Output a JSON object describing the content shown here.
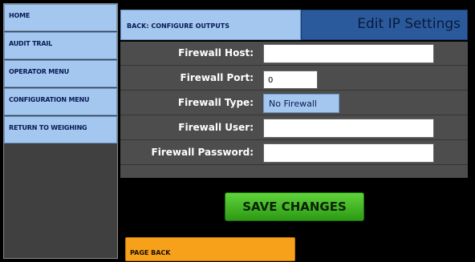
{
  "sidebar": {
    "items": [
      {
        "label": "HOME"
      },
      {
        "label": "AUDIT TRAIL"
      },
      {
        "label": "OPERATOR MENU"
      },
      {
        "label": "CONFIGURATION MENU"
      },
      {
        "label": "RETURN TO WEIGHING"
      }
    ]
  },
  "header": {
    "back_label": "BACK: CONFIGURE OUTPUTS",
    "title": "Edit IP Settings"
  },
  "form": {
    "host": {
      "label": "Firewall Host:",
      "value": ""
    },
    "port": {
      "label": "Firewall Port:",
      "value": "0"
    },
    "type": {
      "label": "Firewall Type:",
      "value": "No Firewall"
    },
    "user": {
      "label": "Firewall User:",
      "value": ""
    },
    "password": {
      "label": "Firewall Password:",
      "value": ""
    }
  },
  "actions": {
    "save_label": "SAVE CHANGES",
    "page_back_label": "PAGE BACK"
  },
  "colors": {
    "button_blue": "#a3c7ee",
    "title_blue": "#2b5a9c",
    "save_green": "#3db41e",
    "page_back_orange": "#f7a11a",
    "panel_gray": "#4d4d4d"
  }
}
